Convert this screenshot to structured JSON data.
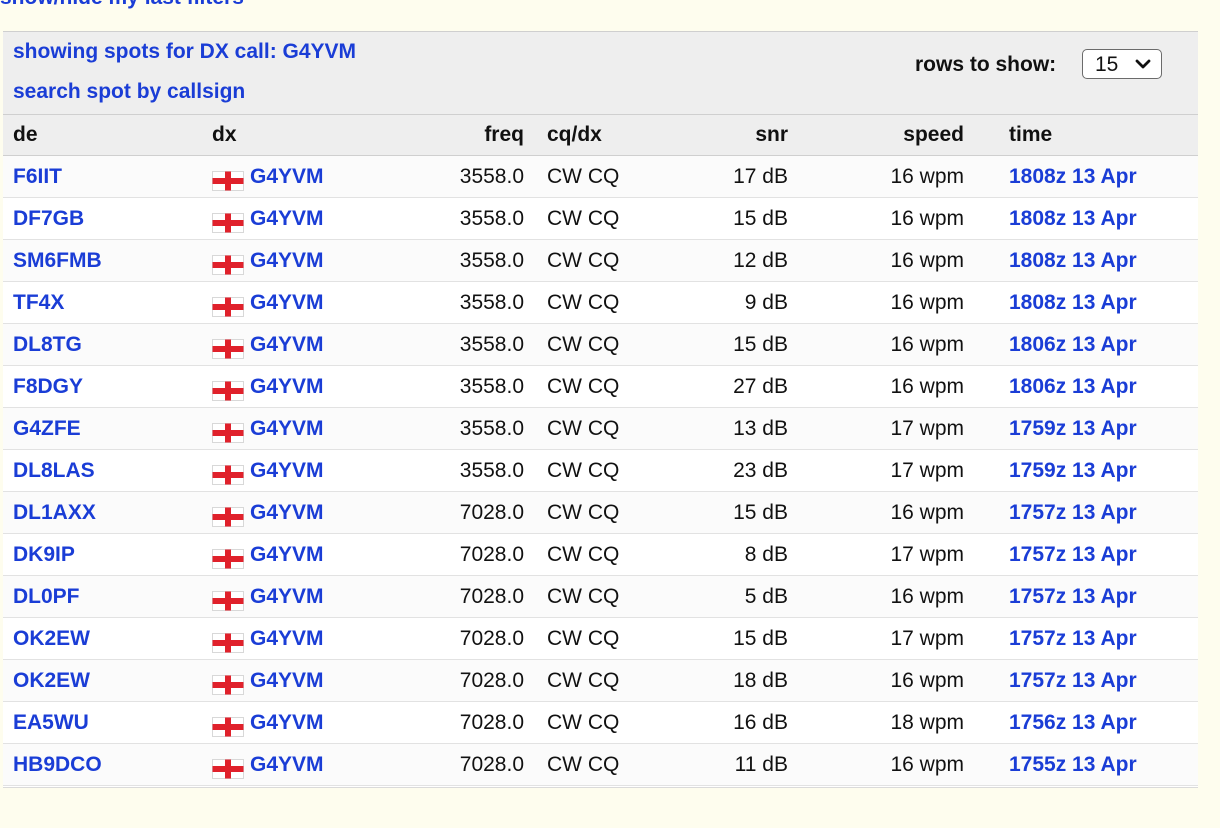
{
  "top_link": "show/hide my last filters",
  "header": {
    "showing_spots": "showing spots for DX call: G4YVM",
    "search_link": "search spot by callsign",
    "rows_label": "rows to show:",
    "rows_value": "15"
  },
  "columns": {
    "de": "de",
    "dx": "dx",
    "freq": "freq",
    "cqdx": "cq/dx",
    "snr": "snr",
    "speed": "speed",
    "time": "time"
  },
  "colors": {
    "link": "#1a3dd6",
    "background": "#fefdee",
    "header_bg": "#eeeeee",
    "flag_cross": "#e0212b"
  },
  "flag_icon": "england-flag-icon",
  "spots": [
    {
      "de": "F6IIT",
      "dx": "G4YVM",
      "freq": "3558.0",
      "mode": "CW CQ",
      "snr": "17 dB",
      "speed": "16 wpm",
      "time": "1808z 13 Apr"
    },
    {
      "de": "DF7GB",
      "dx": "G4YVM",
      "freq": "3558.0",
      "mode": "CW CQ",
      "snr": "15 dB",
      "speed": "16 wpm",
      "time": "1808z 13 Apr"
    },
    {
      "de": "SM6FMB",
      "dx": "G4YVM",
      "freq": "3558.0",
      "mode": "CW CQ",
      "snr": "12 dB",
      "speed": "16 wpm",
      "time": "1808z 13 Apr"
    },
    {
      "de": "TF4X",
      "dx": "G4YVM",
      "freq": "3558.0",
      "mode": "CW CQ",
      "snr": "9 dB",
      "speed": "16 wpm",
      "time": "1808z 13 Apr"
    },
    {
      "de": "DL8TG",
      "dx": "G4YVM",
      "freq": "3558.0",
      "mode": "CW CQ",
      "snr": "15 dB",
      "speed": "16 wpm",
      "time": "1806z 13 Apr"
    },
    {
      "de": "F8DGY",
      "dx": "G4YVM",
      "freq": "3558.0",
      "mode": "CW CQ",
      "snr": "27 dB",
      "speed": "16 wpm",
      "time": "1806z 13 Apr"
    },
    {
      "de": "G4ZFE",
      "dx": "G4YVM",
      "freq": "3558.0",
      "mode": "CW CQ",
      "snr": "13 dB",
      "speed": "17 wpm",
      "time": "1759z 13 Apr"
    },
    {
      "de": "DL8LAS",
      "dx": "G4YVM",
      "freq": "3558.0",
      "mode": "CW CQ",
      "snr": "23 dB",
      "speed": "17 wpm",
      "time": "1759z 13 Apr"
    },
    {
      "de": "DL1AXX",
      "dx": "G4YVM",
      "freq": "7028.0",
      "mode": "CW CQ",
      "snr": "15 dB",
      "speed": "16 wpm",
      "time": "1757z 13 Apr"
    },
    {
      "de": "DK9IP",
      "dx": "G4YVM",
      "freq": "7028.0",
      "mode": "CW CQ",
      "snr": "8 dB",
      "speed": "17 wpm",
      "time": "1757z 13 Apr"
    },
    {
      "de": "DL0PF",
      "dx": "G4YVM",
      "freq": "7028.0",
      "mode": "CW CQ",
      "snr": "5 dB",
      "speed": "16 wpm",
      "time": "1757z 13 Apr"
    },
    {
      "de": "OK2EW",
      "dx": "G4YVM",
      "freq": "7028.0",
      "mode": "CW CQ",
      "snr": "15 dB",
      "speed": "17 wpm",
      "time": "1757z 13 Apr"
    },
    {
      "de": "OK2EW",
      "dx": "G4YVM",
      "freq": "7028.0",
      "mode": "CW CQ",
      "snr": "18 dB",
      "speed": "16 wpm",
      "time": "1757z 13 Apr"
    },
    {
      "de": "EA5WU",
      "dx": "G4YVM",
      "freq": "7028.0",
      "mode": "CW CQ",
      "snr": "16 dB",
      "speed": "18 wpm",
      "time": "1756z 13 Apr"
    },
    {
      "de": "HB9DCO",
      "dx": "G4YVM",
      "freq": "7028.0",
      "mode": "CW CQ",
      "snr": "11 dB",
      "speed": "16 wpm",
      "time": "1755z 13 Apr"
    }
  ]
}
